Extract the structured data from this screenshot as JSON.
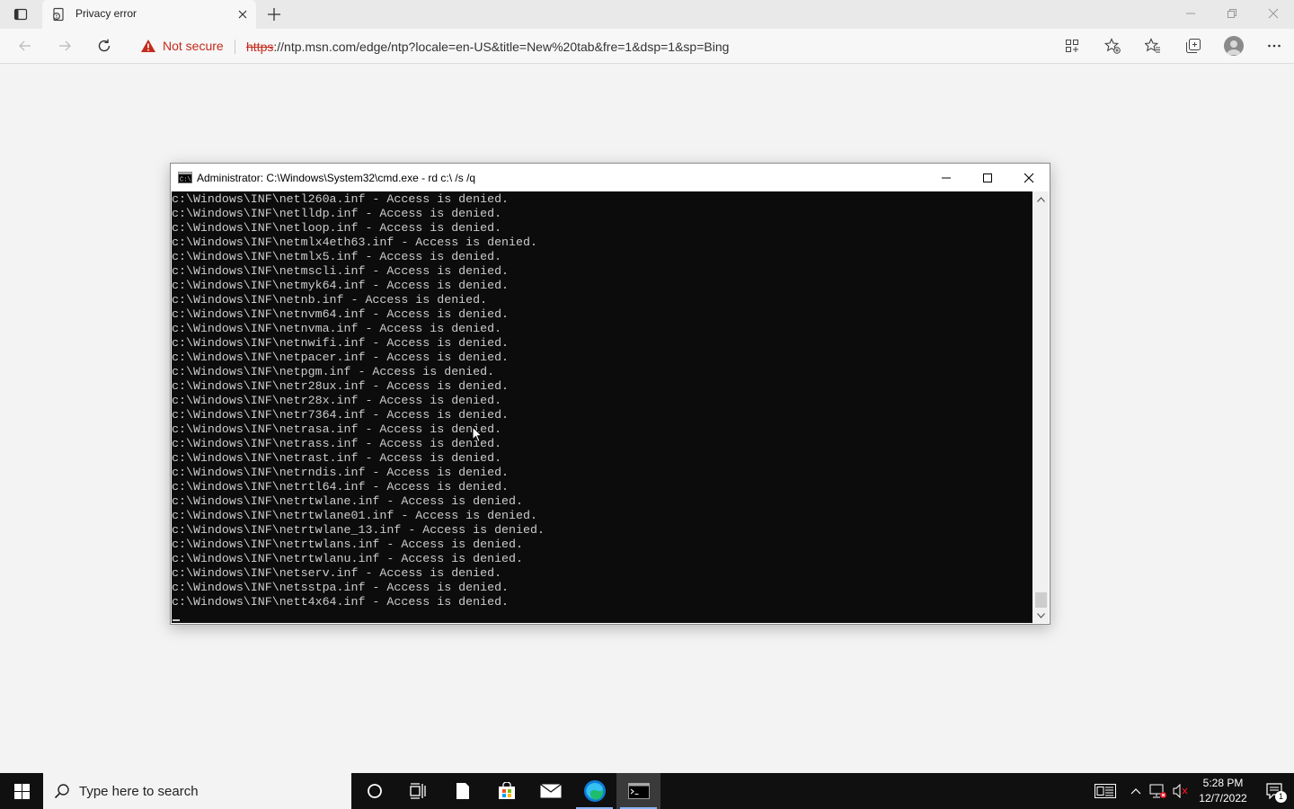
{
  "browser": {
    "tab_title": "Privacy error",
    "security_label": "Not secure",
    "url_scheme": "https",
    "url_rest": "://ntp.msn.com/edge/ntp?locale=en-US&title=New%20tab&fre=1&dsp=1&sp=Bing"
  },
  "cmd": {
    "title": "Administrator: C:\\Windows\\System32\\cmd.exe - rd  c:\\ /s /q",
    "lines": [
      "c:\\Windows\\INF\\netl260a.inf - Access is denied.",
      "c:\\Windows\\INF\\netlldp.inf - Access is denied.",
      "c:\\Windows\\INF\\netloop.inf - Access is denied.",
      "c:\\Windows\\INF\\netmlx4eth63.inf - Access is denied.",
      "c:\\Windows\\INF\\netmlx5.inf - Access is denied.",
      "c:\\Windows\\INF\\netmscli.inf - Access is denied.",
      "c:\\Windows\\INF\\netmyk64.inf - Access is denied.",
      "c:\\Windows\\INF\\netnb.inf - Access is denied.",
      "c:\\Windows\\INF\\netnvm64.inf - Access is denied.",
      "c:\\Windows\\INF\\netnvma.inf - Access is denied.",
      "c:\\Windows\\INF\\netnwifi.inf - Access is denied.",
      "c:\\Windows\\INF\\netpacer.inf - Access is denied.",
      "c:\\Windows\\INF\\netpgm.inf - Access is denied.",
      "c:\\Windows\\INF\\netr28ux.inf - Access is denied.",
      "c:\\Windows\\INF\\netr28x.inf - Access is denied.",
      "c:\\Windows\\INF\\netr7364.inf - Access is denied.",
      "c:\\Windows\\INF\\netrasa.inf - Access is denied.",
      "c:\\Windows\\INF\\netrass.inf - Access is denied.",
      "c:\\Windows\\INF\\netrast.inf - Access is denied.",
      "c:\\Windows\\INF\\netrndis.inf - Access is denied.",
      "c:\\Windows\\INF\\netrtl64.inf - Access is denied.",
      "c:\\Windows\\INF\\netrtwlane.inf - Access is denied.",
      "c:\\Windows\\INF\\netrtwlane01.inf - Access is denied.",
      "c:\\Windows\\INF\\netrtwlane_13.inf - Access is denied.",
      "c:\\Windows\\INF\\netrtwlans.inf - Access is denied.",
      "c:\\Windows\\INF\\netrtwlanu.inf - Access is denied.",
      "c:\\Windows\\INF\\netserv.inf - Access is denied.",
      "c:\\Windows\\INF\\netsstpa.inf - Access is denied.",
      "c:\\Windows\\INF\\nett4x64.inf - Access is denied."
    ]
  },
  "taskbar": {
    "search_placeholder": "Type here to search",
    "time": "5:28 PM",
    "date": "12/7/2022",
    "notification_count": "1"
  },
  "colors": {
    "warning": "#c42b1c",
    "console_bg": "#0c0c0c",
    "console_text": "#cccccc",
    "taskbar": "#101010"
  }
}
